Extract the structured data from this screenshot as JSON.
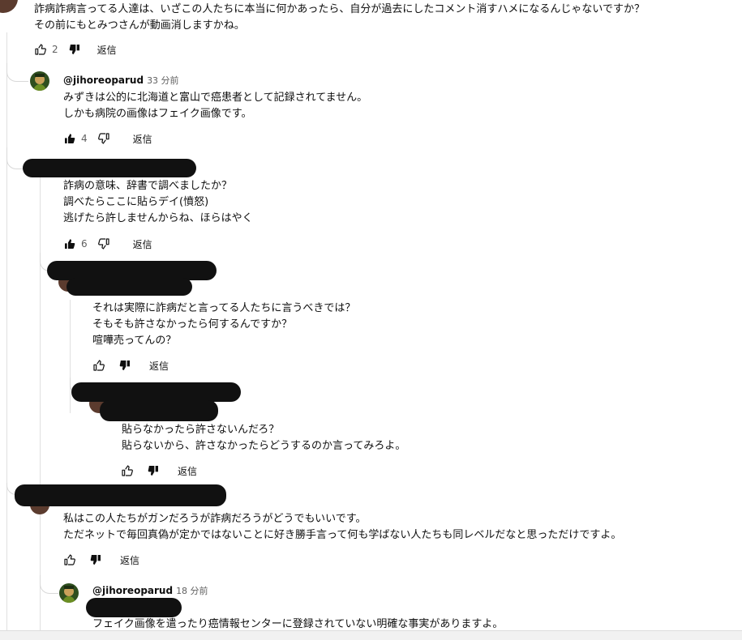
{
  "colors": {
    "text": "#0f0f0f",
    "muted": "#606060",
    "line": "#e0e0e0",
    "redaction": "#111111",
    "avatar_dark": "#5b3b2e"
  },
  "comments": [
    {
      "author": "",
      "time": "",
      "lines": [
        "詐病詐病言ってる人達は、いざこの人たちに本当に何かあったら、自分が過去にしたコメント消すハメになるんじゃないですか？",
        "その前にもとみつさんが動画消しますかね。"
      ],
      "likes": "2",
      "reply_label": "返信"
    },
    {
      "author": "@jihoreoparud",
      "time": "33 分前",
      "lines": [
        "みずきは公的に北海道と富山で癌患者として記録されてません。",
        "しかも病院の画像はフェイク画像です。"
      ],
      "likes": "4",
      "reply_label": "返信"
    },
    {
      "author": "",
      "time": "",
      "lines": [
        "詐病の意味、辞書で調べましたか？",
        "調べたらここに貼らデイ(憤怒)",
        "逃げたら許しませんからね、ほらはやく"
      ],
      "likes": "6",
      "reply_label": "返信"
    },
    {
      "author": "",
      "time": "",
      "lines": [
        "それは実際に詐病だと言ってる人たちに言うべきでは？",
        "そもそも許さなかったら何するんですか？",
        "喧嘩売ってんの？"
      ],
      "likes": "",
      "reply_label": "返信"
    },
    {
      "author": "",
      "time": "",
      "lines": [
        "貼らなかったら許さないんだろ？",
        "貼らないから、許さなかったらどうするのか言ってみろよ。"
      ],
      "likes": "",
      "reply_label": "返信"
    },
    {
      "author": "",
      "time": "",
      "lines": [
        "私はこの人たちがガンだろうが詐病だろうがどうでもいいです。",
        "ただネットで毎回真偽が定かではないことに好き勝手言って何も学ばない人たちも同レベルだなと思っただけですよ。"
      ],
      "likes": "",
      "reply_label": "返信"
    },
    {
      "author": "@jihoreoparud",
      "time": "18 分前",
      "lines": [
        "フェイク画像を遣ったり癌情報センターに登録されていない明確な事実がありますよ。"
      ],
      "likes": "",
      "reply_label": ""
    }
  ],
  "icons": {
    "like": "thumb-up-icon",
    "dislike": "thumb-down-icon"
  }
}
